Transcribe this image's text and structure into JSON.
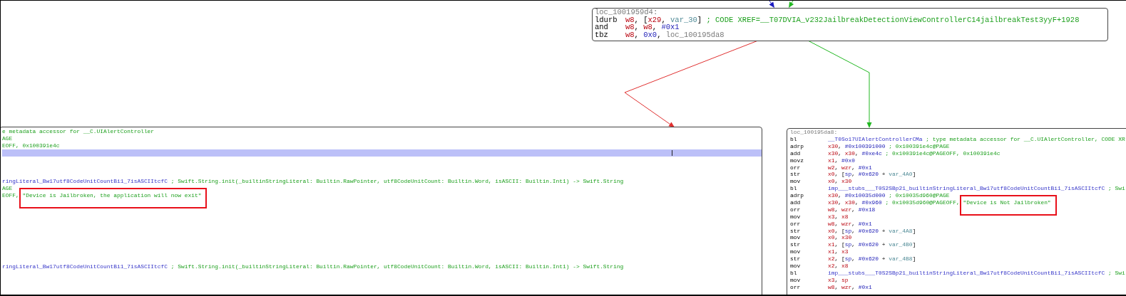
{
  "graph": {
    "edges": [
      {
        "kind": "flow"
      },
      {
        "kind": "branch_taken"
      },
      {
        "kind": "branch_not_taken"
      },
      {
        "kind": "branch_taken"
      }
    ],
    "blocks": [
      {
        "kind": "top",
        "label": "loc_1001959d4:",
        "lines": [
          {
            "kind": "code",
            "mnemonic": "ldurb",
            "tokens": [
              {
                "kind": "register",
                "text": "w8"
              },
              {
                "kind": "plain",
                "text": ", ["
              },
              {
                "kind": "register",
                "text": "x29"
              },
              {
                "kind": "plain",
                "text": ", "
              },
              {
                "kind": "variable",
                "text": "var_30"
              },
              {
                "kind": "plain",
                "text": "] "
              },
              {
                "kind": "comment",
                "text": "; CODE XREF=__T07DVIA_v232JailbreakDetectionViewControllerC14jailbreakTest3yyF+1928"
              }
            ]
          },
          {
            "kind": "code",
            "mnemonic": "and",
            "tokens": [
              {
                "kind": "register",
                "text": "w8"
              },
              {
                "kind": "plain",
                "text": ", "
              },
              {
                "kind": "register",
                "text": "w8"
              },
              {
                "kind": "plain",
                "text": ", "
              },
              {
                "kind": "number",
                "text": "#0x1"
              }
            ]
          },
          {
            "kind": "code",
            "mnemonic": "tbz",
            "tokens": [
              {
                "kind": "register",
                "text": "w8"
              },
              {
                "kind": "plain",
                "text": ", "
              },
              {
                "kind": "number",
                "text": "0x0"
              },
              {
                "kind": "plain",
                "text": ", "
              },
              {
                "kind": "label",
                "text": "loc_100195da8"
              }
            ]
          }
        ]
      },
      {
        "kind": "left",
        "lines": [
          {
            "kind": "code",
            "tokens": [
              {
                "kind": "comment",
                "text": "e metadata accessor for __C.UIAlertController"
              }
            ]
          },
          {
            "kind": "code",
            "tokens": [
              {
                "kind": "comment",
                "text": "AGE"
              }
            ]
          },
          {
            "kind": "code",
            "tokens": [
              {
                "kind": "comment",
                "text": "EOFF, 0x100391e4c"
              }
            ]
          },
          {
            "kind": "cursor_line"
          },
          {
            "kind": "blank"
          },
          {
            "kind": "blank"
          },
          {
            "kind": "blank"
          },
          {
            "kind": "code",
            "tokens": [
              {
                "kind": "symbol",
                "text": "ringLiteral_Bw17utf8CodeUnitCountBi1_7isASCIItcfC"
              },
              {
                "kind": "comment",
                "text": " ; Swift.String.init(_builtinStringLiteral: Builtin.RawPointer, utf8CodeUnitCount: Builtin.Word, isASCII: Builtin.Int1) -> Swift.String"
              }
            ]
          },
          {
            "kind": "code",
            "tokens": [
              {
                "kind": "comment",
                "text": "AGE"
              }
            ]
          },
          {
            "kind": "code",
            "tokens": [
              {
                "kind": "comment",
                "text": "EOFF, "
              },
              {
                "kind": "string",
                "boxed": true,
                "text": "\"Device is Jailbroken, the application will now exit\""
              }
            ]
          },
          {
            "kind": "blank"
          },
          {
            "kind": "blank"
          },
          {
            "kind": "blank"
          },
          {
            "kind": "blank"
          },
          {
            "kind": "blank"
          },
          {
            "kind": "blank"
          },
          {
            "kind": "blank"
          },
          {
            "kind": "blank"
          },
          {
            "kind": "blank"
          },
          {
            "kind": "code",
            "tokens": [
              {
                "kind": "symbol",
                "text": "ringLiteral_Bw17utf8CodeUnitCountBi1_7isASCIItcfC"
              },
              {
                "kind": "comment",
                "text": " ; Swift.String.init(_builtinStringLiteral: Builtin.RawPointer, utf8CodeUnitCount: Builtin.Word, isASCII: Builtin.Int1) -> Swift.String"
              }
            ]
          }
        ]
      },
      {
        "kind": "right",
        "label": "loc_100195da8:",
        "lines": [
          {
            "kind": "code",
            "mnemonic": "bl",
            "tokens": [
              {
                "kind": "symbol",
                "text": "__T0So17UIAlertControllerCMa"
              },
              {
                "kind": "comment",
                "text": " ; type metadata accessor for __C.UIAlertController, CODE XR"
              }
            ]
          },
          {
            "kind": "code",
            "mnemonic": "adrp",
            "tokens": [
              {
                "kind": "register",
                "text": "x30"
              },
              {
                "kind": "plain",
                "text": ", "
              },
              {
                "kind": "number",
                "text": "#0x100391000"
              },
              {
                "kind": "comment",
                "text": " ; 0x100391e4c@PAGE"
              }
            ]
          },
          {
            "kind": "code",
            "mnemonic": "add",
            "tokens": [
              {
                "kind": "register",
                "text": "x30"
              },
              {
                "kind": "plain",
                "text": ", "
              },
              {
                "kind": "register",
                "text": "x30"
              },
              {
                "kind": "plain",
                "text": ", "
              },
              {
                "kind": "number",
                "text": "#0xe4c"
              },
              {
                "kind": "comment",
                "text": " ; 0x100391e4c@PAGEOFF, 0x100391e4c"
              }
            ]
          },
          {
            "kind": "code",
            "mnemonic": "movz",
            "tokens": [
              {
                "kind": "register",
                "text": "x1"
              },
              {
                "kind": "plain",
                "text": ", "
              },
              {
                "kind": "number",
                "text": "#0x0"
              }
            ]
          },
          {
            "kind": "code",
            "mnemonic": "orr",
            "tokens": [
              {
                "kind": "register",
                "text": "w2"
              },
              {
                "kind": "plain",
                "text": ", "
              },
              {
                "kind": "register",
                "text": "wzr"
              },
              {
                "kind": "plain",
                "text": ", "
              },
              {
                "kind": "number",
                "text": "#0x1"
              }
            ]
          },
          {
            "kind": "code",
            "mnemonic": "str",
            "tokens": [
              {
                "kind": "register",
                "text": "x0"
              },
              {
                "kind": "plain",
                "text": ", ["
              },
              {
                "kind": "number",
                "text": "sp"
              },
              {
                "kind": "plain",
                "text": ", "
              },
              {
                "kind": "number",
                "text": "#0x620"
              },
              {
                "kind": "plain",
                "text": " + "
              },
              {
                "kind": "variable",
                "text": "var_4A0"
              },
              {
                "kind": "plain",
                "text": "]"
              }
            ]
          },
          {
            "kind": "code",
            "mnemonic": "mov",
            "tokens": [
              {
                "kind": "register",
                "text": "x0"
              },
              {
                "kind": "plain",
                "text": ", "
              },
              {
                "kind": "register",
                "text": "x30"
              }
            ]
          },
          {
            "kind": "code",
            "mnemonic": "bl",
            "tokens": [
              {
                "kind": "symbol",
                "text": "imp___stubs___T0S2SBp21_builtinStringLiteral_Bw17utf8CodeUnitCountBi1_7isASCIItcfC"
              },
              {
                "kind": "comment",
                "text": " ; Swi"
              }
            ]
          },
          {
            "kind": "code",
            "mnemonic": "adrp",
            "tokens": [
              {
                "kind": "register",
                "text": "x30"
              },
              {
                "kind": "plain",
                "text": ", "
              },
              {
                "kind": "number",
                "text": "#0x10035d000"
              },
              {
                "kind": "comment",
                "text": " ; 0x10035d960@PAGE"
              }
            ]
          },
          {
            "kind": "code",
            "mnemonic": "add",
            "tokens": [
              {
                "kind": "register",
                "text": "x30"
              },
              {
                "kind": "plain",
                "text": ", "
              },
              {
                "kind": "register",
                "text": "x30"
              },
              {
                "kind": "plain",
                "text": ", "
              },
              {
                "kind": "number",
                "text": "#0x960"
              },
              {
                "kind": "comment",
                "text": " ; 0x10035d960@PAGEOFF, "
              },
              {
                "kind": "string",
                "boxed": true,
                "text": "\"Device is Not Jailbroken\""
              }
            ]
          },
          {
            "kind": "code",
            "mnemonic": "orr",
            "tokens": [
              {
                "kind": "register",
                "text": "w8"
              },
              {
                "kind": "plain",
                "text": ", "
              },
              {
                "kind": "register",
                "text": "wzr"
              },
              {
                "kind": "plain",
                "text": ", "
              },
              {
                "kind": "number",
                "text": "#0x18"
              }
            ]
          },
          {
            "kind": "code",
            "mnemonic": "mov",
            "tokens": [
              {
                "kind": "register",
                "text": "x3"
              },
              {
                "kind": "plain",
                "text": ", "
              },
              {
                "kind": "register",
                "text": "x8"
              }
            ]
          },
          {
            "kind": "code",
            "mnemonic": "orr",
            "tokens": [
              {
                "kind": "register",
                "text": "w8"
              },
              {
                "kind": "plain",
                "text": ", "
              },
              {
                "kind": "register",
                "text": "wzr"
              },
              {
                "kind": "plain",
                "text": ", "
              },
              {
                "kind": "number",
                "text": "#0x1"
              }
            ]
          },
          {
            "kind": "code",
            "mnemonic": "str",
            "tokens": [
              {
                "kind": "register",
                "text": "x0"
              },
              {
                "kind": "plain",
                "text": ", ["
              },
              {
                "kind": "number",
                "text": "sp"
              },
              {
                "kind": "plain",
                "text": ", "
              },
              {
                "kind": "number",
                "text": "#0x620"
              },
              {
                "kind": "plain",
                "text": " + "
              },
              {
                "kind": "variable",
                "text": "var_4A8"
              },
              {
                "kind": "plain",
                "text": "]"
              }
            ]
          },
          {
            "kind": "code",
            "mnemonic": "mov",
            "tokens": [
              {
                "kind": "register",
                "text": "x0"
              },
              {
                "kind": "plain",
                "text": ", "
              },
              {
                "kind": "register",
                "text": "x30"
              }
            ]
          },
          {
            "kind": "code",
            "mnemonic": "str",
            "tokens": [
              {
                "kind": "register",
                "text": "x1"
              },
              {
                "kind": "plain",
                "text": ", ["
              },
              {
                "kind": "number",
                "text": "sp"
              },
              {
                "kind": "plain",
                "text": ", "
              },
              {
                "kind": "number",
                "text": "#0x620"
              },
              {
                "kind": "plain",
                "text": " + "
              },
              {
                "kind": "variable",
                "text": "var_4B0"
              },
              {
                "kind": "plain",
                "text": "]"
              }
            ]
          },
          {
            "kind": "code",
            "mnemonic": "mov",
            "tokens": [
              {
                "kind": "register",
                "text": "x1"
              },
              {
                "kind": "plain",
                "text": ", "
              },
              {
                "kind": "register",
                "text": "x3"
              }
            ]
          },
          {
            "kind": "code",
            "mnemonic": "str",
            "tokens": [
              {
                "kind": "register",
                "text": "x2"
              },
              {
                "kind": "plain",
                "text": ", ["
              },
              {
                "kind": "number",
                "text": "sp"
              },
              {
                "kind": "plain",
                "text": ", "
              },
              {
                "kind": "number",
                "text": "#0x620"
              },
              {
                "kind": "plain",
                "text": " + "
              },
              {
                "kind": "variable",
                "text": "var_4B8"
              },
              {
                "kind": "plain",
                "text": "]"
              }
            ]
          },
          {
            "kind": "code",
            "mnemonic": "mov",
            "tokens": [
              {
                "kind": "register",
                "text": "x2"
              },
              {
                "kind": "plain",
                "text": ", "
              },
              {
                "kind": "register",
                "text": "x8"
              }
            ]
          },
          {
            "kind": "code",
            "mnemonic": "bl",
            "tokens": [
              {
                "kind": "symbol",
                "text": "imp___stubs___T0S2SBp21_builtinStringLiteral_Bw17utf8CodeUnitCountBi1_7isASCIItcfC"
              },
              {
                "kind": "comment",
                "text": " ; Swi"
              }
            ]
          },
          {
            "kind": "code",
            "mnemonic": "mov",
            "tokens": [
              {
                "kind": "register",
                "text": "x3"
              },
              {
                "kind": "plain",
                "text": ", "
              },
              {
                "kind": "register",
                "text": "sp"
              }
            ]
          },
          {
            "kind": "code",
            "mnemonic": "orr",
            "tokens": [
              {
                "kind": "register",
                "text": "w8"
              },
              {
                "kind": "plain",
                "text": ", "
              },
              {
                "kind": "register",
                "text": "wzr"
              },
              {
                "kind": "plain",
                "text": ", "
              },
              {
                "kind": "number",
                "text": "#0x1"
              }
            ]
          }
        ]
      }
    ]
  }
}
